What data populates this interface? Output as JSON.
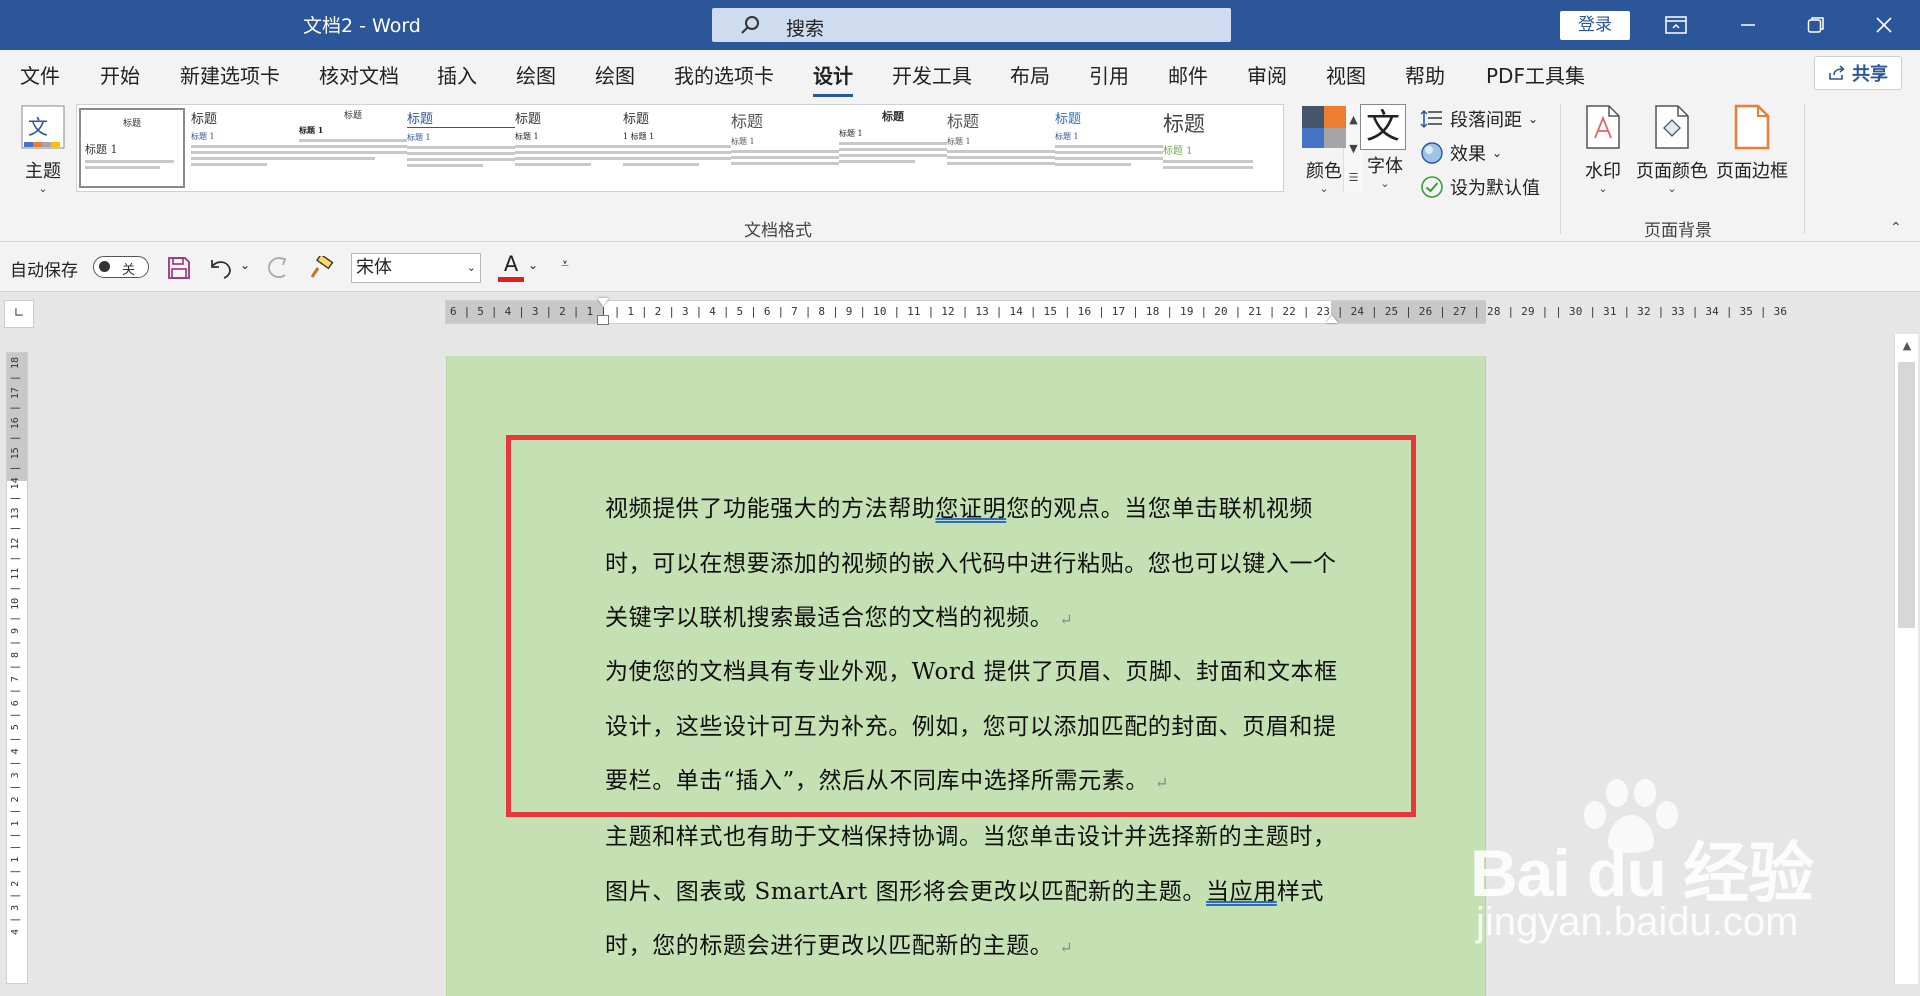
{
  "titlebar": {
    "doc_title": "文档2  -  Word",
    "search_label": "搜索",
    "login_label": "登录"
  },
  "menu": {
    "items": [
      "文件",
      "开始",
      "新建选项卡",
      "核对文档",
      "插入",
      "绘图",
      "绘图",
      "我的选项卡",
      "设计",
      "开发工具",
      "布局",
      "引用",
      "邮件",
      "审阅",
      "视图",
      "帮助",
      "PDF工具集"
    ],
    "active_index": 8,
    "share_label": "共享"
  },
  "ribbon": {
    "theme_label": "主题",
    "style_gallery": [
      {
        "title": "标题",
        "heading": "标题 1"
      },
      {
        "title": "标题",
        "heading": "标题 1"
      },
      {
        "title": "标题",
        "heading": "标题 1"
      },
      {
        "title": "标题",
        "heading": "标题 1"
      },
      {
        "title": "标题",
        "heading": "标题 1"
      },
      {
        "title": "标题",
        "heading": "1  标题 1"
      },
      {
        "title": "标题",
        "heading": "标题 1"
      },
      {
        "title": "标题",
        "heading": "标题 1"
      },
      {
        "title": "标题",
        "heading": "标题 1"
      },
      {
        "title": "标题",
        "heading": "标题 1"
      },
      {
        "title": "标题",
        "heading": "标题 1"
      }
    ],
    "colors_label": "颜色",
    "fonts_label": "字体",
    "fonts_glyph": "文",
    "paragraph_spacing_label": "段落间距",
    "effects_label": "效果",
    "set_default_label": "设为默认值",
    "group_docformat_label": "文档格式",
    "watermark_label": "水印",
    "page_color_label": "页面颜色",
    "page_border_label": "页面边框",
    "group_pagebg_label": "页面背景"
  },
  "qat": {
    "autosave_label": "自动保存",
    "autosave_state": "关",
    "font_name": "宋体",
    "font_color_letter": "A"
  },
  "ruler": {
    "horizontal_labels": "6 | 5 | 4 | 3 | 2 | 1 |   | 1 | 2 | 3 | 4 | 5 | 6 | 7 | 8 | 9 | 10 | 11 | 12 | 13 | 14 | 15 | 16 | 17 | 18 | 19 | 20 | 21 | 22 | 23 | 24 | 25 | 26 | 27 | 28 | 29 |  | 30 | 31 | 32 | 33 | 34 | 35 | 36",
    "vertical_labels": "4 | 3 | 2 | 1 |  | 1 | 2 | 3 | 4 | 5 | 6 | 7 | 8 | 9 | 10 | 11 | 12 | 13 | 14 | 15 | 16 | 17 | 18"
  },
  "document": {
    "para1_a": "视频提供了功能强大的方法帮助",
    "para1_u": "您证明",
    "para1_b": "您的观点。当您单击联机视频时，可以在想要添加的视频的嵌入代码中进行粘贴。您也可以键入一个关键字以联机搜索最适合您的文档的视频。",
    "para2": "为使您的文档具有专业外观，Word 提供了页眉、页脚、封面和文本框设计，这些设计可互为补充。例如，您可以添加匹配的封面、页眉和提要栏。单击“插入”，然后从不同库中选择所需元素。",
    "para3_a": "主题和样式也有助于文档保持协调。当您单击设计并选择新的主题时，图片、图表或 SmartArt 图形将会更改以匹配新的主题。",
    "para3_u": "当应用",
    "para3_b": "样式时，您的标题会进行更改以匹配新的主题。",
    "paragraph_mark": "↵"
  },
  "watermark": {
    "brand": "Bai du 经验",
    "url": "jingyan.baidu.com"
  },
  "colors": {
    "titlebar": "#2b579a",
    "page_background": "#c5e0b3",
    "highlight_border": "#e8373a",
    "font_color_bar": "#e02020"
  }
}
